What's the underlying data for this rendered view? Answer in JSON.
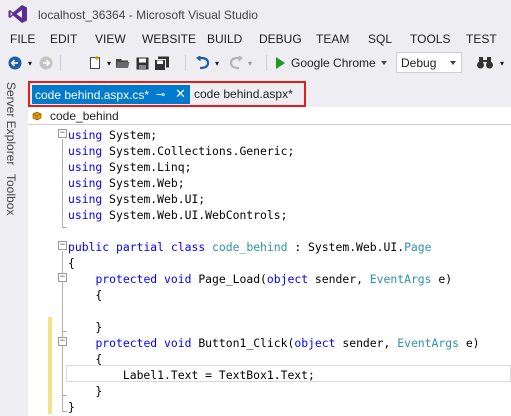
{
  "window": {
    "title": "localhost_36364 - Microsoft Visual Studio"
  },
  "menu": [
    "FILE",
    "EDIT",
    "VIEW",
    "WEBSITE",
    "BUILD",
    "DEBUG",
    "TEAM",
    "SQL",
    "TOOLS",
    "TEST"
  ],
  "toolbar": {
    "browser_label": "Google Chrome",
    "config_value": "Debug"
  },
  "side_tabs": [
    "Server Explorer",
    "Toolbox"
  ],
  "doc_tabs": {
    "active": "code behind.aspx.cs*",
    "inactive": "code behind.aspx*"
  },
  "nav": {
    "class_name": "code_behind"
  },
  "code": {
    "lines": [
      [
        [
          "kw",
          "using"
        ],
        [
          "p",
          " System;"
        ]
      ],
      [
        [
          "kw",
          "using"
        ],
        [
          "p",
          " System.Collections.Generic;"
        ]
      ],
      [
        [
          "kw",
          "using"
        ],
        [
          "p",
          " System.Linq;"
        ]
      ],
      [
        [
          "kw",
          "using"
        ],
        [
          "p",
          " System.Web;"
        ]
      ],
      [
        [
          "kw",
          "using"
        ],
        [
          "p",
          " System.Web.UI;"
        ]
      ],
      [
        [
          "kw",
          "using"
        ],
        [
          "p",
          " System.Web.UI.WebControls;"
        ]
      ],
      [],
      [
        [
          "kw",
          "public"
        ],
        [
          "p",
          " "
        ],
        [
          "kw",
          "partial"
        ],
        [
          "p",
          " "
        ],
        [
          "kw",
          "class"
        ],
        [
          "p",
          " "
        ],
        [
          "ty",
          "code_behind"
        ],
        [
          "p",
          " : System.Web.UI."
        ],
        [
          "ty",
          "Page"
        ]
      ],
      [
        [
          "p",
          "{"
        ]
      ],
      [
        [
          "p",
          "    "
        ],
        [
          "kw",
          "protected"
        ],
        [
          "p",
          " "
        ],
        [
          "kw",
          "void"
        ],
        [
          "p",
          " Page_Load("
        ],
        [
          "kw",
          "object"
        ],
        [
          "p",
          " sender, "
        ],
        [
          "ty",
          "EventArgs"
        ],
        [
          "p",
          " e)"
        ]
      ],
      [
        [
          "p",
          "    {"
        ]
      ],
      [],
      [
        [
          "p",
          "    }"
        ]
      ],
      [
        [
          "p",
          "    "
        ],
        [
          "kw",
          "protected"
        ],
        [
          "p",
          " "
        ],
        [
          "kw",
          "void"
        ],
        [
          "p",
          " Button1_Click("
        ],
        [
          "kw",
          "object"
        ],
        [
          "p",
          " sender, "
        ],
        [
          "ty",
          "EventArgs"
        ],
        [
          "p",
          " e)"
        ]
      ],
      [
        [
          "p",
          "    {"
        ]
      ],
      [
        [
          "p",
          "        Label1.Text = TextBox1.Text;"
        ]
      ],
      [
        [
          "p",
          "    }"
        ]
      ],
      [
        [
          "p",
          "}"
        ]
      ]
    ]
  }
}
